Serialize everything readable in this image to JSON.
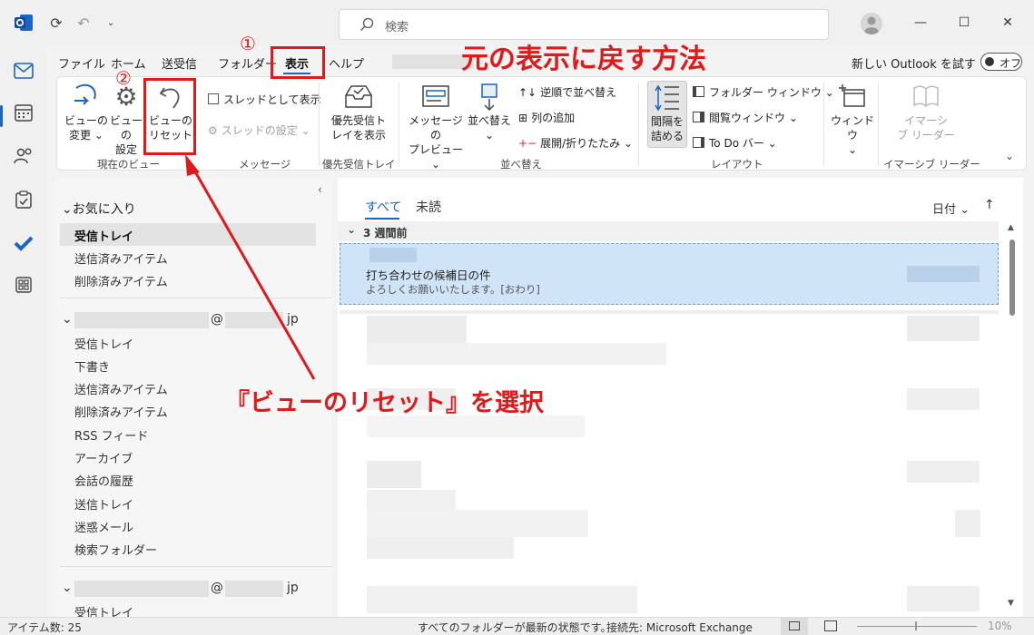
{
  "titlebar": {
    "search_placeholder": "検索"
  },
  "menu": {
    "tabs": [
      "ファイル",
      "ホーム",
      "送受信",
      "フォルダー",
      "表示",
      "ヘルプ"
    ],
    "new_outlook_label": "新しい Outlook を試す",
    "toggle_label": "オフ"
  },
  "ribbon": {
    "view_change": "ビューの\n変更 ⌄",
    "view_settings": "ビューの\n設定",
    "view_reset": "ビューの\nリセット",
    "thread_show": "スレッドとして表示",
    "thread_settings": "スレッドの設定 ⌄",
    "focused_inbox": "優先受信ト\nレイを表示",
    "message_preview": "メッセージの\nプレビュー ⌄",
    "sort": "並べ替え\n⌄",
    "reverse_sort": "逆順で並べ替え",
    "add_column": "列の追加",
    "expand_collapse": "展開/折りたたみ ⌄",
    "spacing": "間隔を\n詰める",
    "folder_window": "フォルダー ウィンドウ ⌄",
    "reading_window": "閲覧ウィンドウ ⌄",
    "todo_bar": "To Do バー ⌄",
    "window": "ウィンドウ\n⌄",
    "immersive_reader": "イマーシ\nブ リーダー",
    "groups": {
      "current_view": "現在のビュー",
      "messages": "メッセージ",
      "focused": "優先受信トレイ",
      "sort": "並べ替え",
      "layout": "レイアウト",
      "immersive": "イマーシブ リーダー"
    }
  },
  "folders": {
    "favorites": "お気に入り",
    "fav_items": [
      "受信トレイ",
      "送信済みアイテム",
      "削除済みアイテム"
    ],
    "account1_suffix": "@",
    "account1_domain": "jp",
    "account1_items": [
      "受信トレイ",
      "下書き",
      "送信済みアイテム",
      "削除済みアイテム",
      "RSS フィード",
      "アーカイブ",
      "会話の履歴",
      "送信トレイ",
      "迷惑メール",
      "検索フォルダー"
    ],
    "account2_suffix": "@",
    "account2_domain": "jp",
    "account2_first": "受信トレイ"
  },
  "messages": {
    "tab_all": "すべて",
    "tab_unread": "未読",
    "sort_label": "日付 ⌄",
    "sort_arrow": "↑",
    "group_header": "3 週間前",
    "selected_subject": "打ち合わせの候補日の件",
    "selected_preview": "よろしくお願いいたします。[おわり]"
  },
  "status": {
    "items": "アイテム数: 25",
    "sync": "すべてのフォルダーが最新の状態です。",
    "connection": "接続先: Microsoft Exchange",
    "zoom": "10%"
  },
  "annotations": {
    "title": "元の表示に戻す方法",
    "instruction": "『ビューのリセット』を選択",
    "step1": "①",
    "step2": "②"
  },
  "colors": {
    "accent": "#1a64c6",
    "annotation_red": "#e0191b",
    "selected_row": "#cfe4f7"
  }
}
